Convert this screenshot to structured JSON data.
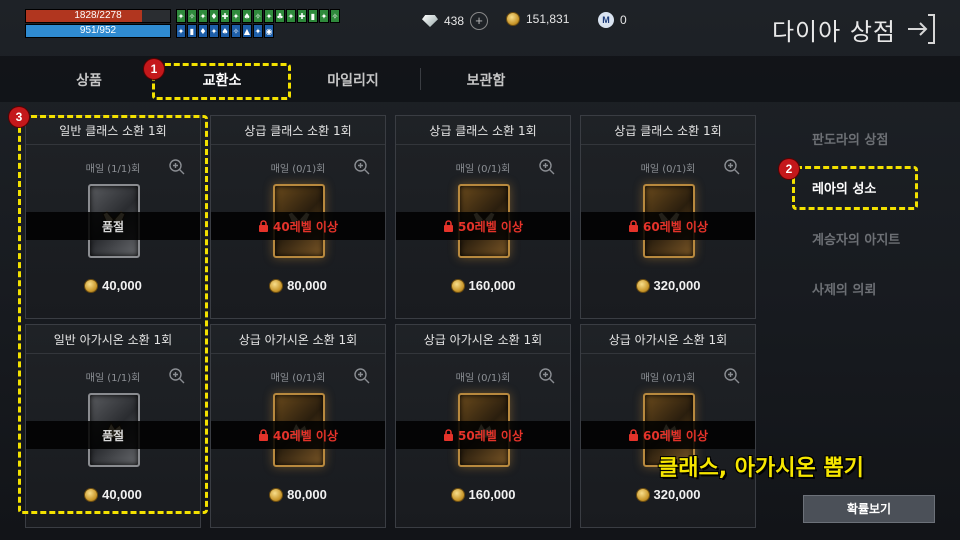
{
  "hud": {
    "hp": "1828/2278",
    "hp_ratio": 0.8025,
    "mp": "951/952",
    "mp_ratio": 0.999,
    "hp_color": "#b1361f",
    "mp_color": "#2f8bd1"
  },
  "currency": {
    "diamond": "438",
    "gold": "151,831",
    "mileage": "0",
    "mileage_icon_letter": "M"
  },
  "shop_title": "다이아 상점",
  "tabs": [
    {
      "label": "상품",
      "active": false
    },
    {
      "label": "교환소",
      "active": true
    },
    {
      "label": "마일리지",
      "active": false
    },
    {
      "label": "보관함",
      "active": false
    }
  ],
  "cards": [
    {
      "name": "일반 클래스 소환 1회",
      "limit": "매일 (1/1)회",
      "status": "품절",
      "locked": false,
      "price": "40,000",
      "tier": "normal",
      "kind": "class"
    },
    {
      "name": "상급 클래스 소환 1회",
      "limit": "매일 (0/1)회",
      "status": "40레벨 이상",
      "locked": true,
      "price": "80,000",
      "tier": "premium",
      "kind": "class"
    },
    {
      "name": "상급 클래스 소환 1회",
      "limit": "매일 (0/1)회",
      "status": "50레벨 이상",
      "locked": true,
      "price": "160,000",
      "tier": "premium",
      "kind": "class"
    },
    {
      "name": "상급 클래스 소환 1회",
      "limit": "매일 (0/1)회",
      "status": "60레벨 이상",
      "locked": true,
      "price": "320,000",
      "tier": "premium",
      "kind": "class"
    },
    {
      "name": "일반 아가시온 소환 1회",
      "limit": "매일 (1/1)회",
      "status": "품절",
      "locked": false,
      "price": "40,000",
      "tier": "normal",
      "kind": "agathion"
    },
    {
      "name": "상급 아가시온 소환 1회",
      "limit": "매일 (0/1)회",
      "status": "40레벨 이상",
      "locked": true,
      "price": "80,000",
      "tier": "premium",
      "kind": "agathion"
    },
    {
      "name": "상급 아가시온 소환 1회",
      "limit": "매일 (0/1)회",
      "status": "50레벨 이상",
      "locked": true,
      "price": "160,000",
      "tier": "premium",
      "kind": "agathion"
    },
    {
      "name": "상급 아가시온 소환 1회",
      "limit": "매일 (0/1)회",
      "status": "60레벨 이상",
      "locked": true,
      "price": "320,000",
      "tier": "premium",
      "kind": "agathion"
    }
  ],
  "side_menu": [
    {
      "label": "판도라의 상점",
      "active": false
    },
    {
      "label": "레아의 성소",
      "active": true
    },
    {
      "label": "계승자의 아지트",
      "active": false
    },
    {
      "label": "사제의 의뢰",
      "active": false
    }
  ],
  "annotations": {
    "badge1": "1",
    "badge2": "2",
    "badge3": "3",
    "caption": "클래스, 아가시온 뽑기",
    "highlight_color": "#f3e100",
    "badge_color": "#c4181b"
  },
  "probability_button": "확률보기"
}
